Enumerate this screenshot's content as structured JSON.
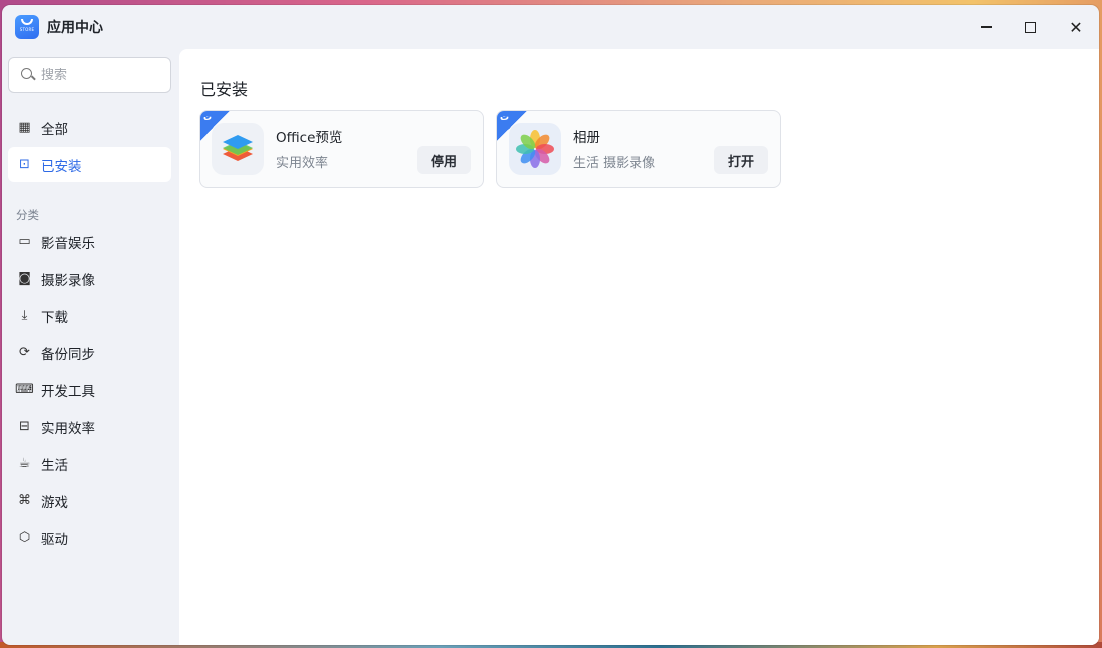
{
  "window": {
    "title": "应用中心",
    "logo_icon": "store-smile-icon",
    "logo_text": "STORE",
    "controls": {
      "minimize_icon": "minimize-icon",
      "maximize_icon": "maximize-icon",
      "close_icon": "close-icon",
      "close_glyph": "✕"
    }
  },
  "sidebar": {
    "search": {
      "placeholder": "搜索",
      "value": ""
    },
    "top_items": [
      {
        "label": "全部",
        "icon": "grid-icon",
        "glyph": "▦",
        "active": false
      },
      {
        "label": "已安装",
        "icon": "installed-icon",
        "glyph": "⊡",
        "active": true
      }
    ],
    "category_label": "分类",
    "categories": [
      {
        "label": "影音娱乐",
        "icon": "video-camera-icon",
        "glyph": "▭"
      },
      {
        "label": "摄影录像",
        "icon": "camera-icon",
        "glyph": "◙"
      },
      {
        "label": "下载",
        "icon": "download-icon",
        "glyph": "⤓"
      },
      {
        "label": "备份同步",
        "icon": "sync-icon",
        "glyph": "⟳"
      },
      {
        "label": "开发工具",
        "icon": "code-icon",
        "glyph": "⌨"
      },
      {
        "label": "实用效率",
        "icon": "toolbox-icon",
        "glyph": "⊟"
      },
      {
        "label": "生活",
        "icon": "cup-icon",
        "glyph": "☕"
      },
      {
        "label": "游戏",
        "icon": "gamepad-icon",
        "glyph": "⌘"
      },
      {
        "label": "驱动",
        "icon": "cube-icon",
        "glyph": "⬡"
      }
    ]
  },
  "main": {
    "section_title": "已安装",
    "apps": [
      {
        "name": "Office预览",
        "category": "实用效率",
        "button": "停用",
        "icon": "office-layers-icon",
        "badge_icon": "official-badge-icon"
      },
      {
        "name": "相册",
        "category": "生活 摄影录像",
        "button": "打开",
        "icon": "photos-flower-icon",
        "badge_icon": "official-badge-icon"
      }
    ]
  },
  "colors": {
    "accent": "#2e6ae6",
    "badge": "#3b7cf0",
    "sidebar_bg": "#f0f2f7",
    "main_bg": "#ffffff"
  }
}
